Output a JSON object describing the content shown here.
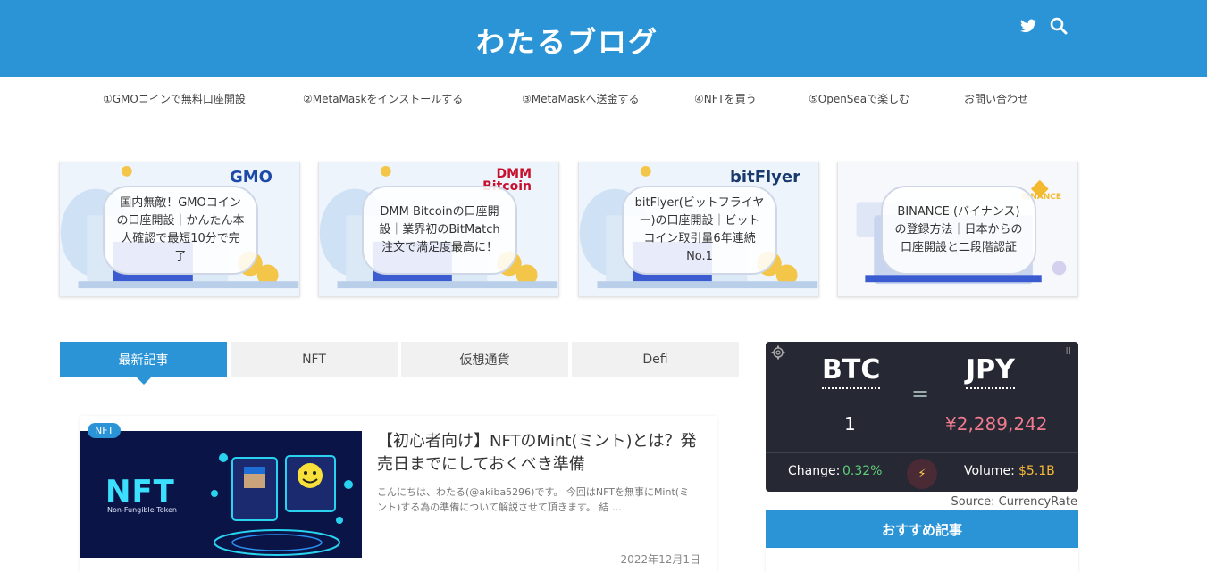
{
  "header": {
    "title": "わたるブログ",
    "icons": [
      "twitter-icon",
      "search-icon"
    ]
  },
  "nav": {
    "items": [
      "①GMOコインで無料口座開設",
      "②MetaMaskをインストールする",
      "③MetaMaskへ送金する",
      "④NFTを買う",
      "⑤OpenSeaで楽しむ",
      "お問い合わせ"
    ]
  },
  "cards": [
    {
      "logo": "GMO",
      "text": "国内無敵！GMOコインの口座開設｜かんたん本人確認で最短10分で完了"
    },
    {
      "logo": "DMM Bitcoin",
      "text": "DMM Bitcoinの口座開設｜業界初のBitMatch注文で満足度最高に！"
    },
    {
      "logo": "bitFlyer",
      "text": "bitFlyer(ビットフライヤー)の口座開設｜ビットコイン取引量6年連続No.1"
    },
    {
      "logo": "BINANCE",
      "text": "BINANCE (バイナンス) の登録方法｜日本からの口座開設と二段階認証"
    }
  ],
  "tabs": [
    "最新記事",
    "NFT",
    "仮想通貨",
    "Defi"
  ],
  "article": {
    "badge": "NFT",
    "title": "【初心者向け】NFTのMint(ミント)とは？発売日までにしておくべき準備",
    "excerpt": "こんにちは、わたる(@akiba5296)です。 今回はNFTを無事にMint(ミント)する為の準備について解説させて頂きます。 結 …",
    "date": "2022年12月1日",
    "thumb_text": "NFT",
    "thumb_sub": "Non-Fungible Token"
  },
  "widget": {
    "from": "BTC",
    "to": "JPY",
    "equals": "=",
    "amount": "1",
    "converted": "¥2,289,242",
    "change_label": "Change:",
    "change_value": "0.32%",
    "volume_label": "Volume:",
    "volume_value": "$5.1B",
    "pause": "II",
    "colors": {
      "converted": "#f07a8e",
      "change": "#5fd07a",
      "volume": "#f5b93a"
    }
  },
  "source": "Source: CurrencyRate",
  "recommended": {
    "title": "おすすめ記事"
  }
}
